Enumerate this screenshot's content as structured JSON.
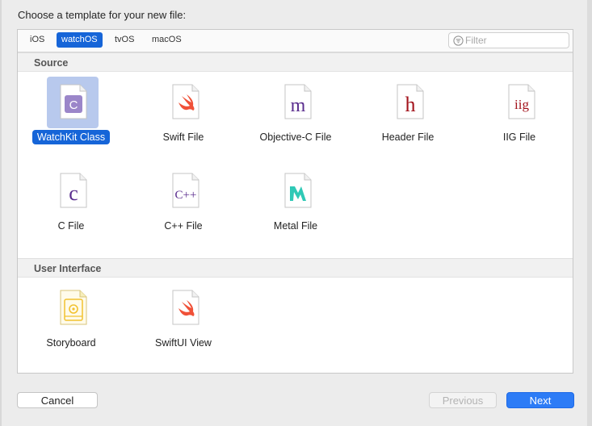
{
  "dialog": {
    "prompt": "Choose a template for your new file:"
  },
  "platform_tabs": [
    {
      "label": "iOS",
      "active": false
    },
    {
      "label": "watchOS",
      "active": true
    },
    {
      "label": "tvOS",
      "active": false
    },
    {
      "label": "macOS",
      "active": false
    }
  ],
  "filter": {
    "placeholder": "Filter",
    "value": ""
  },
  "sections": [
    {
      "title": "Source",
      "items": [
        {
          "label": "WatchKit Class",
          "icon": "class-file-icon",
          "glyph": "C",
          "selected": true
        },
        {
          "label": "Swift File",
          "icon": "swift-file-icon",
          "glyph": "",
          "selected": false
        },
        {
          "label": "Objective-C File",
          "icon": "objective-c-file-icon",
          "glyph": "m",
          "selected": false
        },
        {
          "label": "Header File",
          "icon": "header-file-icon",
          "glyph": "h",
          "selected": false
        },
        {
          "label": "IIG File",
          "icon": "iig-file-icon",
          "glyph": "iig",
          "selected": false
        },
        {
          "label": "C File",
          "icon": "c-file-icon",
          "glyph": "c",
          "selected": false
        },
        {
          "label": "C++ File",
          "icon": "cpp-file-icon",
          "glyph": "C++",
          "selected": false
        },
        {
          "label": "Metal File",
          "icon": "metal-file-icon",
          "glyph": "",
          "selected": false
        }
      ]
    },
    {
      "title": "User Interface",
      "items": [
        {
          "label": "Storyboard",
          "icon": "storyboard-file-icon",
          "glyph": "",
          "selected": false
        },
        {
          "label": "SwiftUI View",
          "icon": "swift-file-icon",
          "glyph": "",
          "selected": false
        }
      ]
    }
  ],
  "buttons": {
    "cancel": "Cancel",
    "previous": "Previous",
    "next": "Next"
  },
  "colors": {
    "accent": "#1665d8",
    "selection_bg": "#b8c9ed",
    "next_button": "#2d7cf6",
    "swift_orange": "#f05138",
    "objc_purple": "#5a2d8e",
    "header_red": "#a3141d",
    "metal_teal": "#2fc9b6",
    "storyboard_yellow": "#f2c230"
  }
}
